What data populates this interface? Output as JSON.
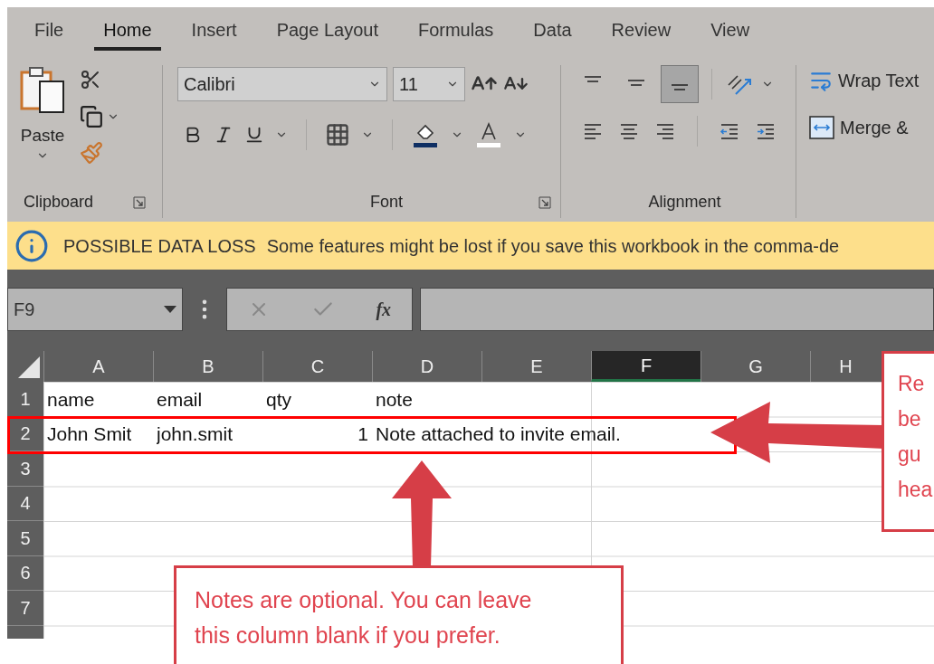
{
  "ribbon_tabs": [
    {
      "label": "File",
      "selected": false
    },
    {
      "label": "Home",
      "selected": true
    },
    {
      "label": "Insert",
      "selected": false
    },
    {
      "label": "Page Layout",
      "selected": false
    },
    {
      "label": "Formulas",
      "selected": false
    },
    {
      "label": "Data",
      "selected": false
    },
    {
      "label": "Review",
      "selected": false
    },
    {
      "label": "View",
      "selected": false
    }
  ],
  "clipboard": {
    "paste_label": "Paste",
    "group_label": "Clipboard"
  },
  "font": {
    "name": "Calibri",
    "size": "11",
    "group_label": "Font"
  },
  "alignment": {
    "group_label": "Alignment",
    "buttons": [
      {
        "kind": "top",
        "selected": false
      },
      {
        "kind": "middle",
        "selected": false
      },
      {
        "kind": "bottom",
        "selected": true
      }
    ]
  },
  "wrap_text": "Wrap Text",
  "merge": "Merge &",
  "info_bar": {
    "title": "POSSIBLE DATA LOSS",
    "message": "Some features might be lost if you save this workbook in the comma-de"
  },
  "formula_bar": {
    "name_box": "F9",
    "fx": "fx"
  },
  "sheet": {
    "columns": [
      {
        "label": "A",
        "selected": false
      },
      {
        "label": "B",
        "selected": false
      },
      {
        "label": "C",
        "selected": false
      },
      {
        "label": "D",
        "selected": false
      },
      {
        "label": "E",
        "selected": false
      },
      {
        "label": "F",
        "selected": true
      },
      {
        "label": "G",
        "selected": false
      },
      {
        "label": "H",
        "selected": false
      }
    ],
    "rows": [
      {
        "label": "1",
        "cells": [
          {
            "text": "name",
            "kind": "text"
          },
          {
            "text": "email",
            "kind": "text"
          },
          {
            "text": "qty",
            "kind": "text"
          },
          {
            "text": "note",
            "kind": "text"
          }
        ]
      },
      {
        "label": "2",
        "cells": [
          {
            "text": "John Smit",
            "kind": "text"
          },
          {
            "text": "john.smit",
            "kind": "text"
          },
          {
            "text": "1",
            "kind": "number"
          },
          {
            "text": "Note attached to invite email.",
            "kind": "text"
          }
        ]
      },
      {
        "label": "3",
        "cells": []
      },
      {
        "label": "4",
        "cells": []
      },
      {
        "label": "5",
        "cells": []
      },
      {
        "label": "6",
        "cells": []
      },
      {
        "label": "7",
        "cells": []
      }
    ]
  },
  "callouts": [
    {
      "kind": "right",
      "lines": [
        "Re",
        "be",
        "gu",
        "hea"
      ]
    },
    {
      "kind": "bottom",
      "lines": [
        "Notes are optional. You can leave",
        "this column blank if you prefer."
      ]
    }
  ]
}
